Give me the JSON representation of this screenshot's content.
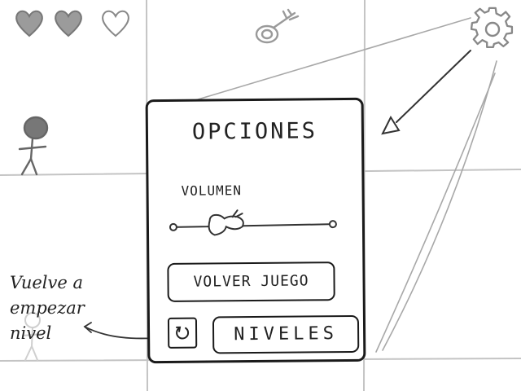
{
  "hud": {
    "hearts": [
      {
        "state": "full",
        "icon": "heart-full-icon"
      },
      {
        "state": "full",
        "icon": "heart-full-icon"
      },
      {
        "state": "empty",
        "icon": "heart-empty-icon"
      }
    ],
    "center_icon": "key-icon",
    "settings_icon": "gear-icon"
  },
  "options": {
    "title": "OPCIONES",
    "volume_label": "VOLUMEN",
    "volume_level": 0.3,
    "resume_button": "VOLVER JUEGO",
    "levels_button": "NIVELES",
    "restart_icon": "restart-icon"
  },
  "annotation": {
    "lines": [
      "Vuelve a",
      "empezar",
      "nivel"
    ]
  }
}
